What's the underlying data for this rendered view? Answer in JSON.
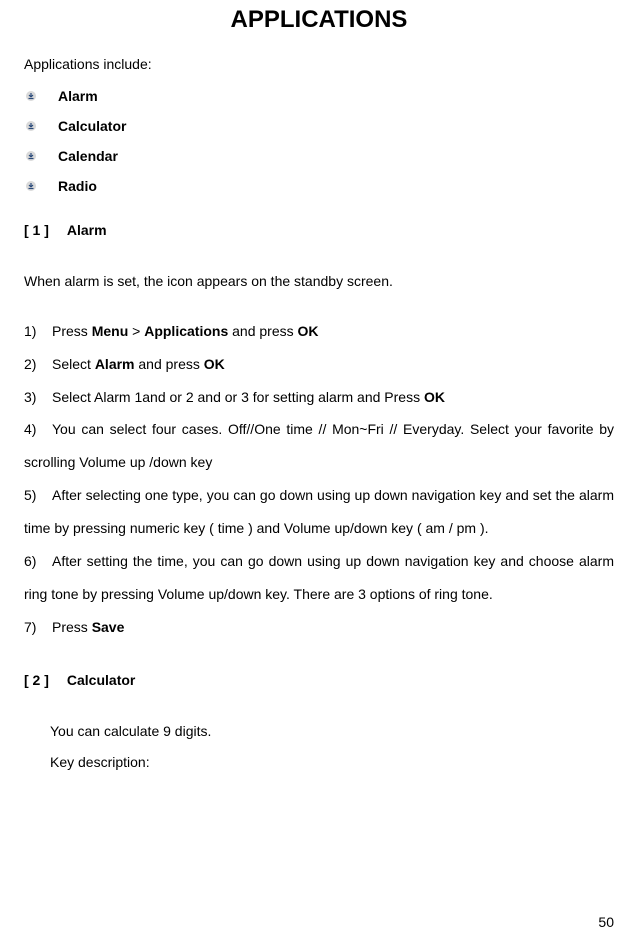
{
  "title": "APPLICATIONS",
  "intro": "Applications include:",
  "bullets": [
    "Alarm",
    "Calculator",
    "Calendar",
    "Radio"
  ],
  "section1": {
    "num": "[ 1 ]",
    "label": "Alarm",
    "desc": "When alarm is set, the icon appears on the standby screen.",
    "steps": {
      "s1_a": "Press ",
      "s1_b": "Menu",
      "s1_c": " > ",
      "s1_d": "Applications",
      "s1_e": " and press ",
      "s1_f": "OK",
      "s2_a": "Select ",
      "s2_b": "Alarm",
      "s2_c": " and press ",
      "s2_d": "OK",
      "s3_a": "Select Alarm 1and or 2 and or 3 for setting alarm and Press ",
      "s3_b": "OK",
      "s4": "You can select four cases. Off//One time // Mon~Fri // Everyday. Select your favorite by scrolling Volume up /down key",
      "s5": "After selecting one type, you can go down using up down navigation key and set the alarm time by pressing numeric key ( time ) and Volume up/down key ( am / pm ).",
      "s6": "After setting the time, you can go down using up down navigation key and choose alarm ring tone by pressing Volume up/down key. There are 3 options of ring tone.",
      "s7_a": "Press ",
      "s7_b": "Save"
    }
  },
  "section2": {
    "num": "[ 2 ]",
    "label": "Calculator",
    "line1": "You can calculate 9 digits.",
    "line2": "Key description:"
  },
  "page_number": "50"
}
